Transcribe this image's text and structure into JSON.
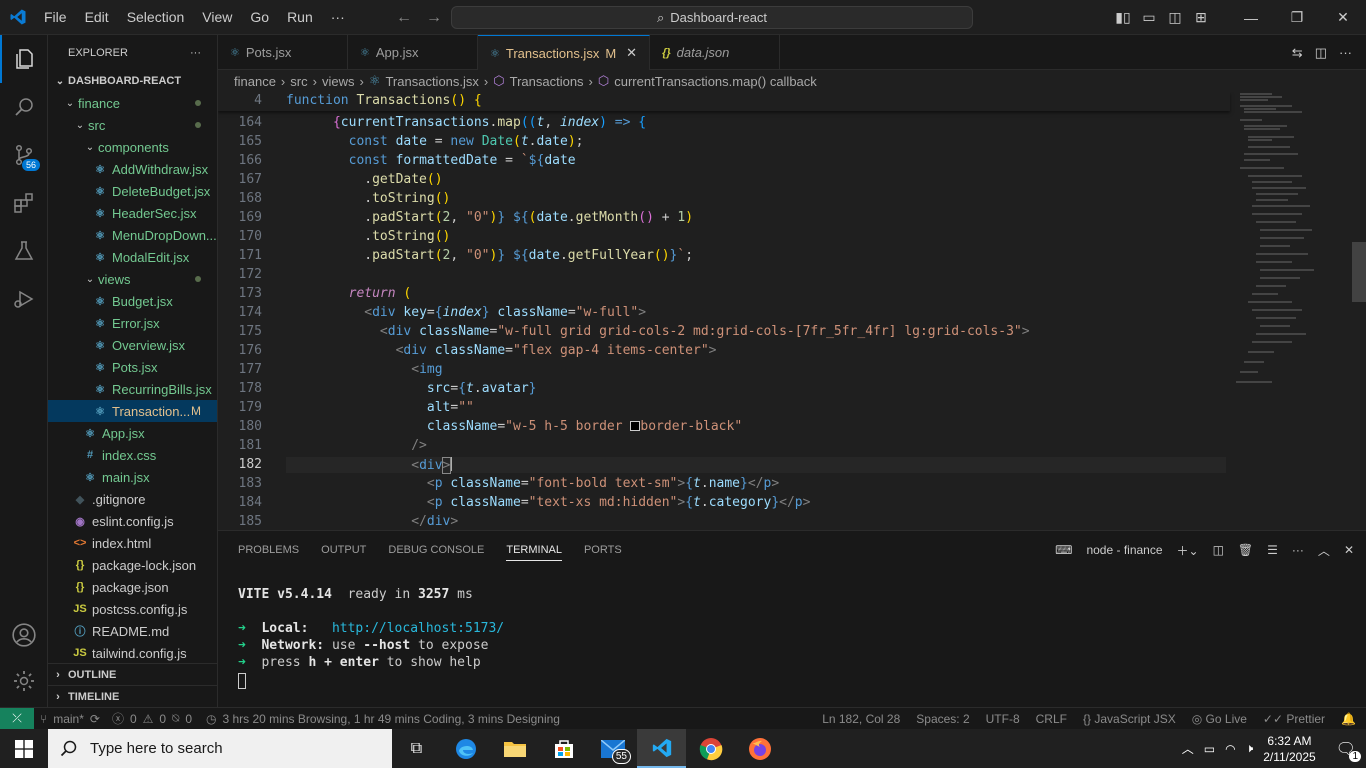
{
  "titlebar": {
    "menu": [
      "File",
      "Edit",
      "Selection",
      "View",
      "Go",
      "Run",
      "···"
    ],
    "search": "Dashboard-react"
  },
  "activity": {
    "source_control_badge": "56"
  },
  "explorer": {
    "header": "EXPLORER",
    "project": "DASHBOARD-REACT",
    "items": [
      {
        "label": "finance",
        "depth": 1,
        "kind": "folder-open",
        "decor": "dot"
      },
      {
        "label": "src",
        "depth": 2,
        "kind": "folder-open",
        "decor": "dot"
      },
      {
        "label": "components",
        "depth": 3,
        "kind": "folder-open",
        "decor": ""
      },
      {
        "label": "AddWithdraw.jsx",
        "depth": 4,
        "kind": "file",
        "decor": ""
      },
      {
        "label": "DeleteBudget.jsx",
        "depth": 4,
        "kind": "file",
        "decor": ""
      },
      {
        "label": "HeaderSec.jsx",
        "depth": 4,
        "kind": "file",
        "decor": ""
      },
      {
        "label": "MenuDropDown...",
        "depth": 4,
        "kind": "file",
        "decor": ""
      },
      {
        "label": "ModalEdit.jsx",
        "depth": 4,
        "kind": "file",
        "decor": ""
      },
      {
        "label": "views",
        "depth": 3,
        "kind": "folder-open",
        "decor": "dot"
      },
      {
        "label": "Budget.jsx",
        "depth": 4,
        "kind": "file",
        "decor": ""
      },
      {
        "label": "Error.jsx",
        "depth": 4,
        "kind": "file",
        "decor": ""
      },
      {
        "label": "Overview.jsx",
        "depth": 4,
        "kind": "file",
        "decor": ""
      },
      {
        "label": "Pots.jsx",
        "depth": 4,
        "kind": "file",
        "decor": ""
      },
      {
        "label": "RecurringBills.jsx",
        "depth": 4,
        "kind": "file",
        "decor": ""
      },
      {
        "label": "Transaction...",
        "depth": 4,
        "kind": "file",
        "decor": "M",
        "selected": true
      },
      {
        "label": "App.jsx",
        "depth": 3,
        "kind": "file",
        "decor": ""
      },
      {
        "label": "index.css",
        "depth": 3,
        "kind": "css",
        "decor": ""
      },
      {
        "label": "main.jsx",
        "depth": 3,
        "kind": "file",
        "decor": ""
      },
      {
        "label": ".gitignore",
        "depth": 2,
        "kind": "git",
        "decor": ""
      },
      {
        "label": "eslint.config.js",
        "depth": 2,
        "kind": "eslint",
        "decor": ""
      },
      {
        "label": "index.html",
        "depth": 2,
        "kind": "html",
        "decor": ""
      },
      {
        "label": "package-lock.json",
        "depth": 2,
        "kind": "json",
        "decor": ""
      },
      {
        "label": "package.json",
        "depth": 2,
        "kind": "json",
        "decor": ""
      },
      {
        "label": "postcss.config.js",
        "depth": 2,
        "kind": "js",
        "decor": ""
      },
      {
        "label": "README.md",
        "depth": 2,
        "kind": "info",
        "decor": ""
      },
      {
        "label": "tailwind.config.js",
        "depth": 2,
        "kind": "js",
        "decor": ""
      }
    ],
    "outline": "OUTLINE",
    "timeline": "TIMELINE"
  },
  "tabs": [
    {
      "label": "Pots.jsx",
      "icon": "react",
      "active": false,
      "flag": ""
    },
    {
      "label": "App.jsx",
      "icon": "react",
      "active": false,
      "flag": ""
    },
    {
      "label": "Transactions.jsx",
      "icon": "react",
      "active": true,
      "flag": "M"
    },
    {
      "label": "data.json",
      "icon": "json",
      "active": false,
      "flag": ""
    }
  ],
  "breadcrumbs": [
    "finance",
    "src",
    "views",
    "Transactions.jsx",
    "Transactions",
    "currentTransactions.map() callback"
  ],
  "editor": {
    "sticky_line": "4",
    "current_line": "182",
    "line_numbers": [
      "164",
      "165",
      "166",
      "167",
      "168",
      "169",
      "170",
      "171",
      "172",
      "173",
      "174",
      "175",
      "176",
      "177",
      "178",
      "179",
      "180",
      "181",
      "182",
      "183",
      "184",
      "185"
    ]
  },
  "panel": {
    "tabs": [
      "PROBLEMS",
      "OUTPUT",
      "DEBUG CONSOLE",
      "TERMINAL",
      "PORTS"
    ],
    "active_tab": "TERMINAL",
    "terminal_name": "node - finance",
    "vite": "VITE v5.4.14",
    "ready": "ready in",
    "ready_ms": "3257",
    "ms": "ms",
    "local_label": "Local:",
    "local_url": "http://localhost:5173/",
    "network_label": "Network:",
    "network_text": "use",
    "network_flag": "--host",
    "network_tail": "to expose",
    "help_pre": "press",
    "help_key": "h + enter",
    "help_post": "to show help"
  },
  "status": {
    "branch": "main*",
    "errors": "0",
    "warnings": "0",
    "ports": "0",
    "activity": "3 hrs 20 mins Browsing, 1 hr 49 mins Coding, 3 mins Designing",
    "position": "Ln 182, Col 28",
    "spaces": "Spaces: 2",
    "encoding": "UTF-8",
    "eol": "CRLF",
    "language": "JavaScript JSX",
    "golive": "Go Live",
    "prettier": "Prettier"
  },
  "taskbar": {
    "search_placeholder": "Type here to search",
    "mail_badge": "55",
    "time": "6:32 AM",
    "date": "2/11/2025",
    "notif": "1"
  }
}
